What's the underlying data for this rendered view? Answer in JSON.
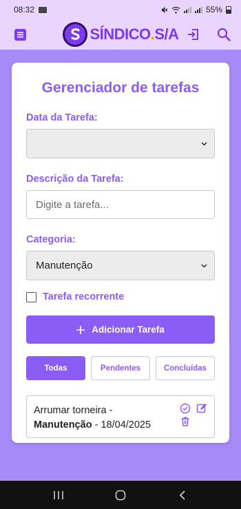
{
  "status_bar": {
    "time": "08:32",
    "battery": "55%"
  },
  "app_bar": {
    "brand_name": "SÍNDICO",
    "brand_dot": ".",
    "brand_suffix": "S/A",
    "brand_color": "#7c3aed",
    "accent_color": "#f59e0b",
    "icons": [
      "menu-icon",
      "logout-icon",
      "search-icon"
    ]
  },
  "card": {
    "title": "Gerenciador de tarefas",
    "date_label": "Data da Tarefa:",
    "date_value": "",
    "description_label": "Descrição da Tarefa:",
    "description_placeholder": "Digite a tarefa...",
    "category_label": "Categoria:",
    "category_value": "Manutenção",
    "recurrent_label": "Tarefa recorrente",
    "recurrent_checked": false,
    "add_button_label": "Adicionar Tarefa"
  },
  "filters": [
    {
      "label": "Todas",
      "active": true
    },
    {
      "label": "Pendentes",
      "active": false
    },
    {
      "label": "Concluídas",
      "active": false
    }
  ],
  "tasks": [
    {
      "title": "Arrumar torneira",
      "separator": " -",
      "category": "Manutenção",
      "date_separator": " - ",
      "date": "18/04/2025"
    }
  ],
  "colors": {
    "primary": "#8b5cf6",
    "page_background": "#a78bfa",
    "header_background": "#e9d5ff"
  }
}
